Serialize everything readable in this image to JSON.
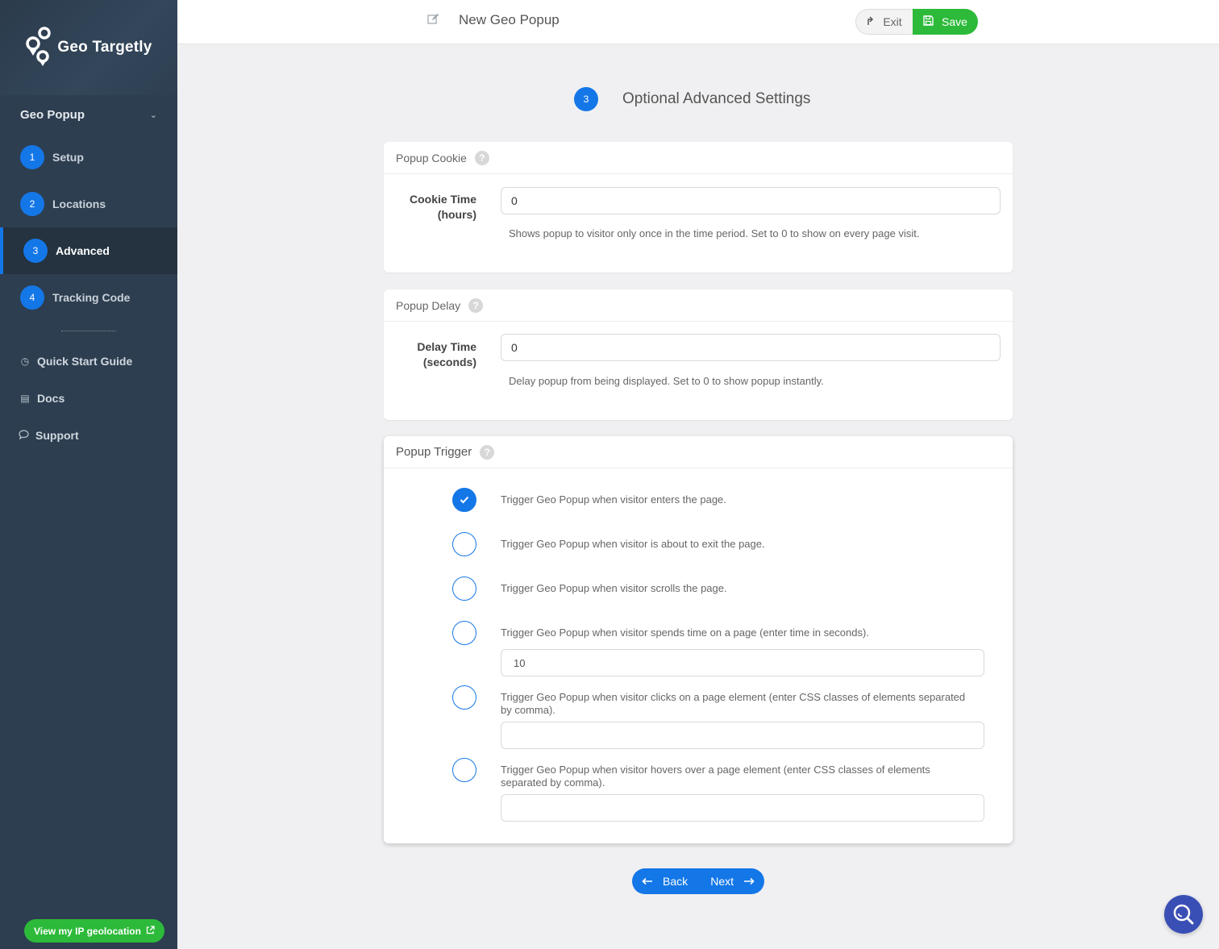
{
  "brand": {
    "name": "Geo Targetly"
  },
  "sidebar": {
    "section_title": "Geo Popup",
    "steps": [
      {
        "num": "1",
        "label": "Setup"
      },
      {
        "num": "2",
        "label": "Locations"
      },
      {
        "num": "3",
        "label": "Advanced"
      },
      {
        "num": "4",
        "label": "Tracking Code"
      }
    ],
    "active_step": "3",
    "links": [
      {
        "label": "Quick Start Guide",
        "icon": "clock-icon"
      },
      {
        "label": "Docs",
        "icon": "book-icon"
      },
      {
        "label": "Support",
        "icon": "chat-bubble-icon"
      }
    ],
    "ip_button": "View my IP geolocation"
  },
  "header": {
    "title": "New Geo Popup",
    "exit_label": "Exit",
    "save_label": "Save"
  },
  "main": {
    "step_num": "3",
    "step_title": "Optional Advanced Settings",
    "cookie": {
      "title": "Popup Cookie",
      "label_line1": "Cookie Time",
      "label_line2": "(hours)",
      "value": "0",
      "hint": "Shows popup to visitor only once in the time period. Set to 0 to show on every page visit."
    },
    "delay": {
      "title": "Popup Delay",
      "label_line1": "Delay Time",
      "label_line2": "(seconds)",
      "value": "0",
      "hint": "Delay popup from being displayed. Set to 0 to show popup instantly."
    },
    "trigger": {
      "title": "Popup Trigger",
      "options": [
        {
          "text": "Trigger Geo Popup when visitor enters the page.",
          "checked": true
        },
        {
          "text": "Trigger Geo Popup when visitor is about to exit the page.",
          "checked": false
        },
        {
          "text": "Trigger Geo Popup when visitor scrolls the page.",
          "checked": false
        },
        {
          "text": "Trigger Geo Popup when visitor spends time on a page (enter time in seconds).",
          "checked": false,
          "input_value": "10"
        },
        {
          "text": "Trigger Geo Popup when visitor clicks on a page element (enter CSS classes of elements separated by comma).",
          "checked": false,
          "input_value": ""
        },
        {
          "text": "Trigger Geo Popup when visitor hovers over a page element (enter CSS classes of elements separated by comma).",
          "checked": false,
          "input_value": ""
        }
      ]
    },
    "back_label": "Back",
    "next_label": "Next"
  },
  "colors": {
    "accent": "#1477e8",
    "save_green": "#2dba3a",
    "sidebar_bg": "#2d3e50"
  }
}
